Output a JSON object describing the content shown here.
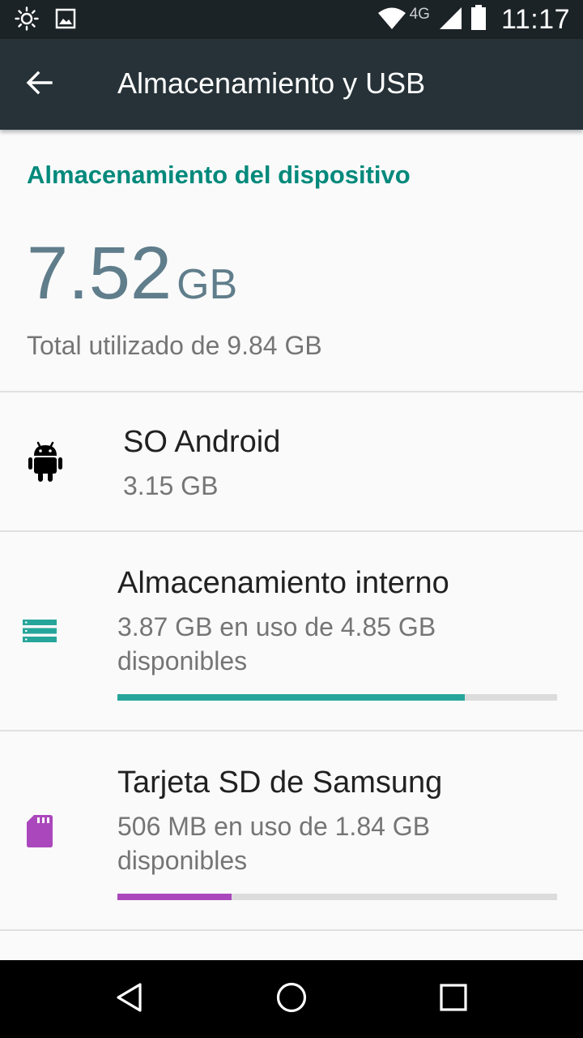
{
  "status_bar": {
    "network_label": "4G",
    "time": "11:17",
    "icons": [
      "brightness-icon",
      "image-notification-icon",
      "wifi-icon",
      "signal-icon",
      "battery-icon"
    ]
  },
  "toolbar": {
    "title": "Almacenamiento y USB",
    "back_icon": "arrow-back-icon"
  },
  "device_storage": {
    "header": "Almacenamiento del dispositivo",
    "used_value": "7.52",
    "used_unit": "GB",
    "total_text": "Total utilizado de 9.84 GB"
  },
  "items": [
    {
      "title": "SO Android",
      "subtitle": "3.15 GB",
      "icon": "android-icon",
      "icon_color": "#000000"
    },
    {
      "title": "Almacenamiento interno",
      "subtitle": "3.87 GB en uso de 4.85 GB disponibles",
      "icon": "storage-icon",
      "icon_color": "#26a69a",
      "progress": 0.79,
      "bar_color": "#26a69a"
    },
    {
      "title": "Tarjeta SD de Samsung",
      "subtitle": "506 MB en uso de 1.84 GB disponibles",
      "icon": "sd-card-icon",
      "icon_color": "#ab47bc",
      "progress": 0.26,
      "bar_color": "#ab47bc"
    }
  ],
  "nav_bar": {
    "buttons": [
      "back-triangle-icon",
      "home-circle-icon",
      "recents-square-icon"
    ]
  },
  "colors": {
    "status_bar": "#1c2327",
    "toolbar": "#263238",
    "accent": "#00897b",
    "total_number": "#607d8b",
    "background": "#fafafa"
  }
}
